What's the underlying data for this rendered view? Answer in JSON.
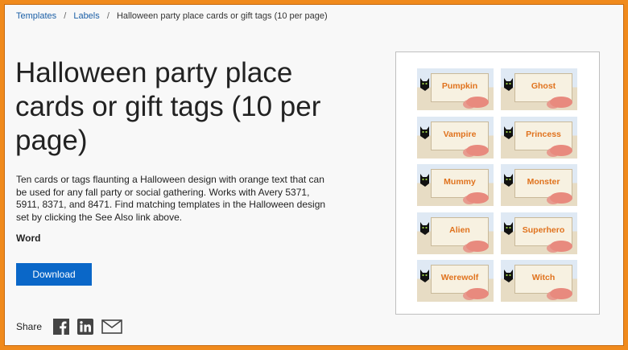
{
  "breadcrumb": {
    "items": [
      "Templates",
      "Labels",
      "Halloween party place cards or gift tags (10 per page)"
    ],
    "separator": "/"
  },
  "title": "Halloween party place cards or gift tags (10 per page)",
  "description": "Ten cards or tags flaunting a Halloween design with orange text that can be used for any fall party or social gathering. Works with Avery 5371, 5911, 8371, and 8471. Find matching templates in the Halloween design set by clicking the See Also link above.",
  "app": "Word",
  "download_label": "Download",
  "share": {
    "label": "Share",
    "icons": [
      "facebook-icon",
      "linkedin-icon",
      "mail-icon"
    ]
  },
  "preview": {
    "cards": [
      "Pumpkin",
      "Ghost",
      "Vampire",
      "Princess",
      "Mummy",
      "Monster",
      "Alien",
      "Superhero",
      "Werewolf",
      "Witch"
    ]
  },
  "colors": {
    "frame": "#f08a1c",
    "accent": "#0a67c8",
    "link": "#1b5fa6",
    "card_text": "#e0721d"
  }
}
